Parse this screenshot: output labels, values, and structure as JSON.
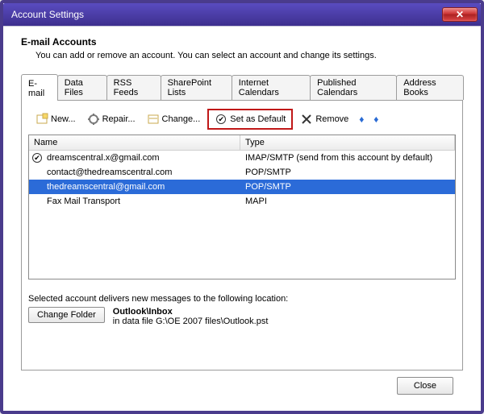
{
  "window": {
    "title": "Account Settings"
  },
  "header": {
    "title": "E-mail Accounts",
    "subtitle": "You can add or remove an account. You can select an account and change its settings."
  },
  "tabs": [
    {
      "label": "E-mail",
      "active": true
    },
    {
      "label": "Data Files"
    },
    {
      "label": "RSS Feeds"
    },
    {
      "label": "SharePoint Lists"
    },
    {
      "label": "Internet Calendars"
    },
    {
      "label": "Published Calendars"
    },
    {
      "label": "Address Books"
    }
  ],
  "toolbar": {
    "new": "New...",
    "repair": "Repair...",
    "change": "Change...",
    "set_default": "Set as Default",
    "remove": "Remove"
  },
  "columns": {
    "name": "Name",
    "type": "Type"
  },
  "accounts": [
    {
      "name": "dreamscentral.x@gmail.com",
      "type": "IMAP/SMTP (send from this account by default)",
      "default": true,
      "selected": false
    },
    {
      "name": "contact@thedreamscentral.com",
      "type": "POP/SMTP",
      "default": false,
      "selected": false
    },
    {
      "name": "thedreamscentral@gmail.com",
      "type": "POP/SMTP",
      "default": false,
      "selected": true
    },
    {
      "name": "Fax Mail Transport",
      "type": "MAPI",
      "default": false,
      "selected": false
    }
  ],
  "delivery": {
    "label": "Selected account delivers new messages to the following location:",
    "change_folder": "Change Folder",
    "location": "Outlook\\Inbox",
    "datafile": "in data file G:\\OE 2007 files\\Outlook.pst"
  },
  "footer": {
    "close": "Close"
  }
}
